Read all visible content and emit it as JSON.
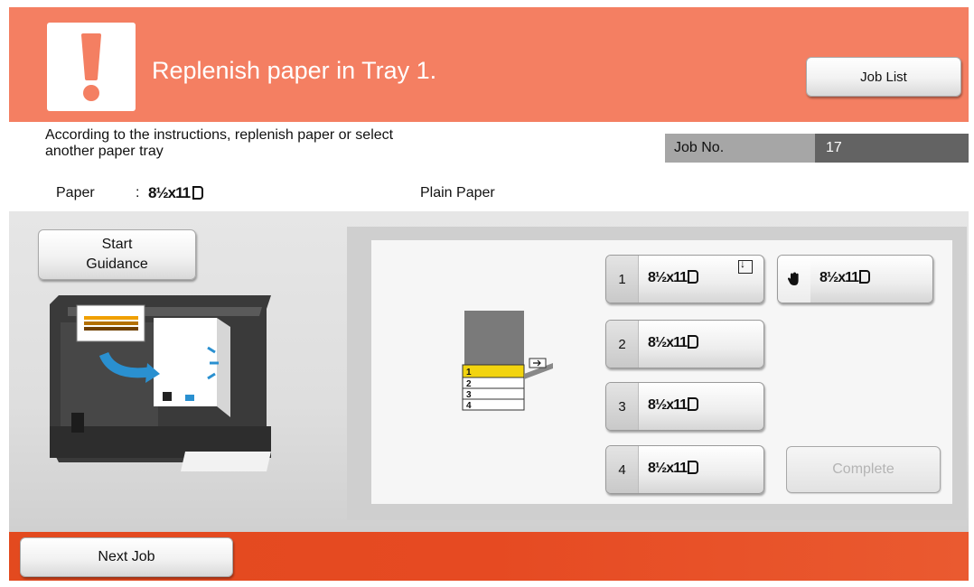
{
  "header": {
    "title": "Replenish paper in Tray 1.",
    "icon": "exclamation-icon",
    "background_color": "#f47f62",
    "job_list_label": "Job List"
  },
  "info": {
    "instruction": "According to the instructions, replenish paper or select another paper tray",
    "job_no_label": "Job No.",
    "job_no_value": "17"
  },
  "paper": {
    "label": "Paper",
    "colon": ":",
    "size": "8½x11",
    "type": "Plain Paper"
  },
  "guidance": {
    "start_label_line1": "Start",
    "start_label_line2": "Guidance"
  },
  "machine_diagram": {
    "tray_numbers": [
      "1",
      "2",
      "3",
      "4"
    ],
    "highlighted_tray": "1",
    "highlight_color": "#f2d40f"
  },
  "trays": [
    {
      "number": "1",
      "size": "8½x11",
      "has_load_icon": true
    },
    {
      "number": "2",
      "size": "8½x11"
    },
    {
      "number": "3",
      "size": "8½x11"
    },
    {
      "number": "4",
      "size": "8½x11"
    }
  ],
  "bypass": {
    "icon": "hand-icon",
    "size": "8½x11"
  },
  "actions": {
    "complete_label": "Complete",
    "next_job_label": "Next Job"
  },
  "footer": {
    "color": "#e34a1f"
  }
}
